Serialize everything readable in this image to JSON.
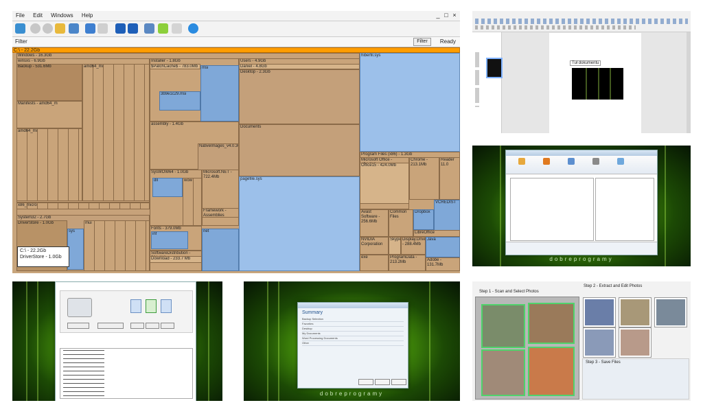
{
  "treemap_app": {
    "menu": [
      "File",
      "Edit",
      "Windows",
      "Help"
    ],
    "filter_label": "Filter",
    "filter_button": "Filter",
    "status": "Ready",
    "blocks": {
      "root": "C:\\ - 22.2Gb",
      "windows": "Windows - 16.3Gb",
      "winsxs": "winsxs - 6.9Gb",
      "backup": "Backup - 531.6Mb",
      "amd64_mi": "amd64_mi",
      "amd64_mi_alt": "amd64_mi",
      "x86_micro": "x86_micro",
      "installer": "Installer - 1.8Gb",
      "patchcache": "$PatchCache$ - 783.0Mb",
      "users": "Users - 4.9Gb",
      "daniel": "Daniel - 4.8Gb",
      "desktop": "Desktop - 2.3Gb",
      "documents": "Documents",
      "wmvfile": "3b9e1c29.msi",
      "manifests": "Manifests - amd64_m",
      "assembly": "assembly - 1.4Gb",
      "nativeimages": "NativeImages_v4.0.30319",
      "appdata": "AppData - 1.6Gb",
      "programfiles": "Program Files (x86) - 1.3Gb",
      "msoffice": "Microsoft Office - 454.6Mb",
      "office15": "Office15 - 424.0Mb",
      "chrome": "Chrome - 213.1Mb",
      "readerx": "Reader 11.0",
      "syswow64": "SysWOW64 - 1.0Gb",
      "dotnet": "Microsoft.NET - 722.4Mb",
      "framework": "Framework - Assemblies",
      "system32": "System32 - 2.7Gb",
      "driverstore": "DriverStore - 1.0Gb",
      "filerepo": "FileRepository - 1.0Gb",
      "fonts": "Fonts - 379.0Mb",
      "softwaredist": "SoftwareDistribution - 521.1Mb",
      "download": "Download - 233.7 Mb",
      "pagefile": "pagefile.sys",
      "hiberfil": "hiberfil.sys",
      "avast": "Avast Software - 256.6Mb",
      "nvidia": "NVIDIA Corporation",
      "display": "Display.Driver - 288.4Mb",
      "programdata": "ProgramData - 213.2Mb",
      "adobe": "Adobe - 131.7Mb",
      "dropbox": "Dropbox",
      "vcredist": "VCREDIST",
      "libreoffice": "LibreOffice",
      "skype": "Skype",
      "java": "Java",
      "common": "Common Files",
      "winsxs_small": "winsxs",
      "dll": "dll",
      "wow": "wow",
      "mui": "mui",
      "inf": "inf",
      "msi": "msi",
      "net": "net",
      "exe": "exe",
      "sys": "sys",
      "cab": "cab"
    },
    "tooltip_title": "C:\\ - 22.2Gb",
    "tooltip_line": "DriverStore - 1.0Gb"
  },
  "thumbs": {
    "editor_text": "Tuł dokumentu",
    "brand": "dobreprogramy",
    "summary_title": "Summary",
    "summary_rows": [
      "Backup Selection",
      "Favorites",
      "Desktop",
      "My Documents",
      "Word Processing Documents",
      "Other"
    ],
    "photo_step1": "Step 1 - Scan and Select Photos",
    "photo_step2": "Step 2 - Extract and Edit Photos",
    "photo_step3": "Step 3 - Save Files"
  },
  "colors": {
    "root_orange": "#ff9d00",
    "file_blue": "#7fa8d8",
    "folder_tan": "#c9a47a",
    "wallpaper_green": "#4e9f0c"
  }
}
